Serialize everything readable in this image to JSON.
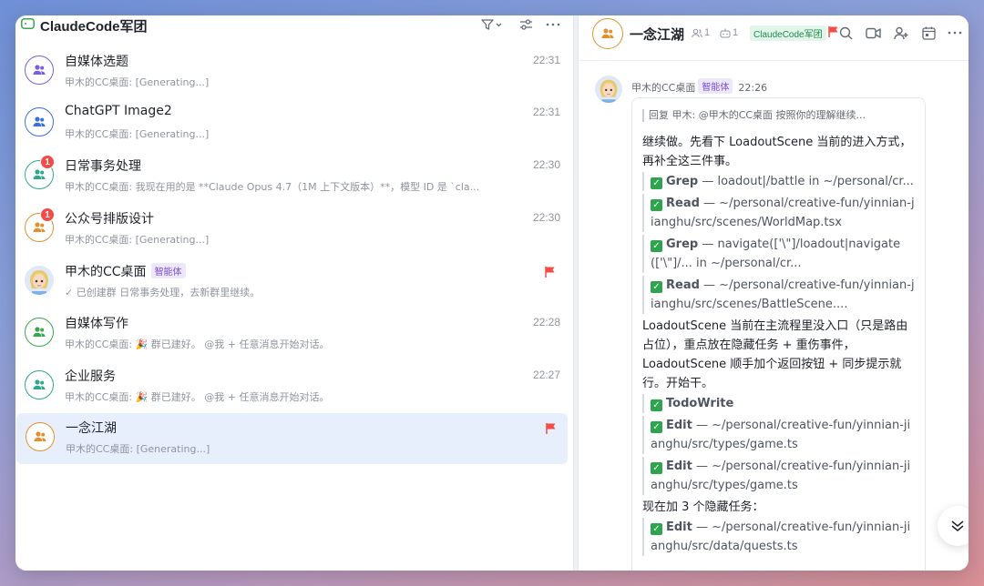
{
  "left": {
    "title": "ClaudeCode军团",
    "conversations": [
      {
        "name": "自媒体选题",
        "time": "22:31",
        "preview": "甲木的CC桌面: [Generating...]",
        "badge": "",
        "color": "#7b5fd8"
      },
      {
        "name": "ChatGPT Image2",
        "time": "22:31",
        "preview": "甲木的CC桌面: [Generating...]",
        "badge": "",
        "color": "#3a6fe0"
      },
      {
        "name": "日常事务处理",
        "time": "22:30",
        "preview": "甲木的CC桌面: 我现在用的是 **Claude Opus 4.7（1M 上下文版本）**，模型 ID 是 `cla...",
        "badge": "1",
        "color": "#2ea88a"
      },
      {
        "name": "公众号排版设计",
        "time": "22:30",
        "preview": "甲木的CC桌面: [Generating...]",
        "badge": "1",
        "color": "#e0912f"
      },
      {
        "name": "甲木的CC桌面",
        "tag": "智能体",
        "time": "",
        "preview": "✓ 已创建群 日常事务处理，去新群里继续。",
        "badge": "",
        "flag": true
      },
      {
        "name": "自媒体写作",
        "time": "22:28",
        "preview": "甲木的CC桌面: 🎉 群已建好。 @我 + 任意消息开始对话。",
        "badge": "",
        "color": "#3aa64d"
      },
      {
        "name": "企业服务",
        "time": "22:27",
        "preview": "甲木的CC桌面: 🎉 群已建好。 @我 + 任意消息开始对话。",
        "badge": "",
        "color": "#2ea88a"
      },
      {
        "name": "一念江湖",
        "time": "",
        "preview": "甲木的CC桌面: [Generating...]",
        "badge": "",
        "color": "#e0912f",
        "flag": true,
        "active": true
      }
    ]
  },
  "right": {
    "title": "一念江湖",
    "members": "1",
    "bots": "1",
    "group_tag": "ClaudeCode军团",
    "sender": "甲木的CC桌面",
    "sender_tag": "智能体",
    "time": "22:26",
    "reply": "回复 甲木: @甲木的CC桌面 按照你的理解继续...",
    "p1": "继续做。先看下 LoadoutScene 当前的进入方式，再补全这三件事。",
    "t1_name": "Grep",
    "t1_text": " — loadout|/battle in ~/personal/cr...",
    "t2_name": "Read",
    "t2_text": " — ~/personal/creative-fun/yinnian-jianghu/src/scenes/WorldMap.tsx",
    "t3_name": "Grep",
    "t3_text": " — navigate(['\\\"]/loadout|navigate(['\\\"]/... in ~/personal/cr...",
    "t4_name": "Read",
    "t4_text": " — ~/personal/creative-fun/yinnian-jianghu/src/scenes/BattleScene....",
    "p2": "LoadoutScene 当前在主流程里没入口（只是路由占位），重点放在隐藏任务 + 重伤事件，LoadoutScene 顺手加个返回按钮 + 同步提示就行。开始干。",
    "t5_name": "TodoWrite",
    "t5_text": "",
    "t6_name": "Edit",
    "t6_text": " — ~/personal/creative-fun/yinnian-jianghu/src/types/game.ts",
    "t7_name": "Edit",
    "t7_text": " — ~/personal/creative-fun/yinnian-jianghu/src/types/game.ts",
    "p3": "现在加 3 个隐藏任务：",
    "t8_name": "Edit",
    "t8_text": " — ~/personal/creative-fun/yinnian-jianghu/src/data/quests.ts"
  },
  "icons": {
    "filter": "filter-icon",
    "settings": "sliders-icon",
    "more": "more-icon",
    "search": "search-icon",
    "video": "video-icon",
    "add_member": "add-member-icon",
    "calendar": "calendar-icon",
    "scroll": "chevron-double-down-icon"
  }
}
